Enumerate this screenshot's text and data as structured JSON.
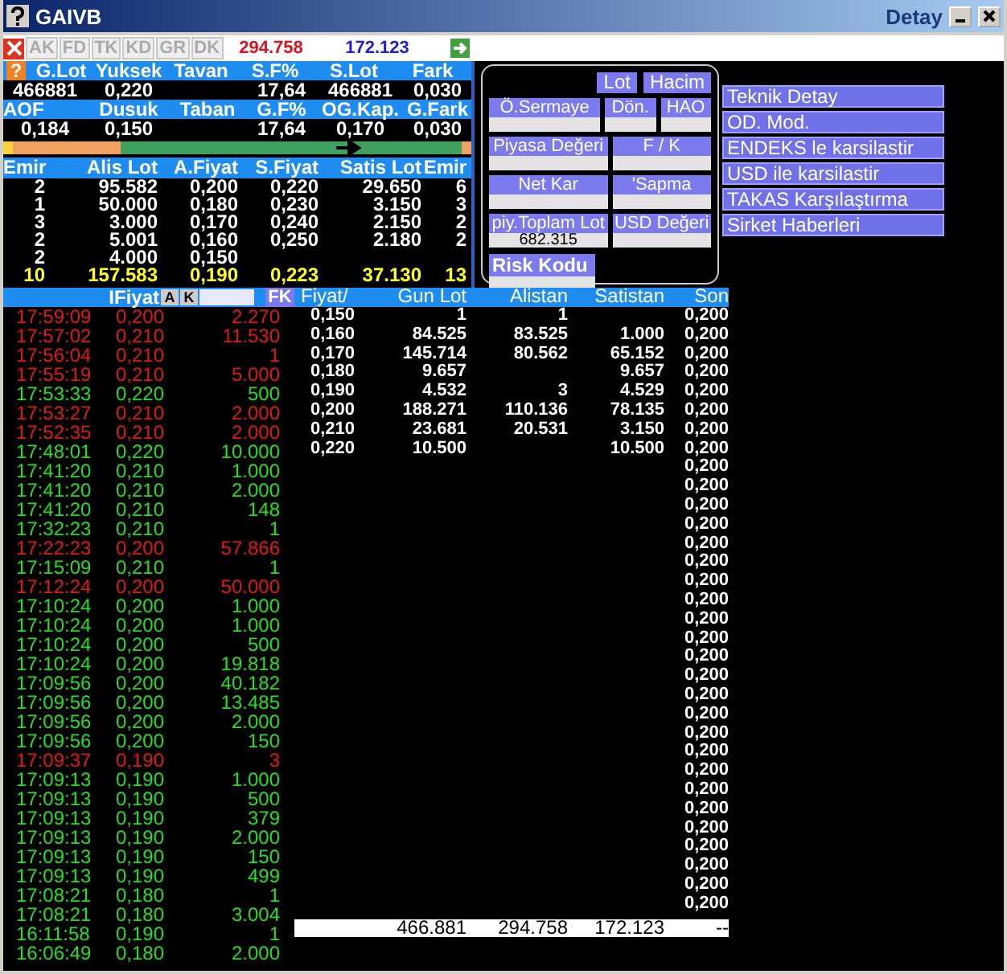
{
  "window": {
    "title": "GAIVB",
    "subtitle": "Detay"
  },
  "toolbar": {
    "tabs": [
      {
        "label": "AK"
      },
      {
        "label": "FD"
      },
      {
        "label": "TK"
      },
      {
        "label": "KD"
      },
      {
        "label": "GR"
      },
      {
        "label": "DK"
      }
    ],
    "sell_total": "294.758",
    "buy_total": "172.123"
  },
  "summary": {
    "help": "?",
    "rows": [
      {
        "kind": "header",
        "cells": [
          "G.Lot",
          "Yuksek",
          "Tavan",
          "S.F%",
          "S.Lot",
          "Fark"
        ]
      },
      {
        "kind": "value",
        "cells": [
          "466881",
          "0,220",
          null,
          "17,64",
          "466881",
          "0,030"
        ]
      },
      {
        "kind": "header",
        "cells": [
          "AOF",
          "Dusuk",
          "Taban",
          "G.F%",
          "OG.Kap.",
          "G.Fark"
        ]
      },
      {
        "kind": "value",
        "cells": [
          "0,184",
          "0,150",
          null,
          "17,64",
          "0,170",
          "0,030"
        ]
      }
    ],
    "balance": {
      "level": 0.24
    }
  },
  "depth": {
    "columns": [
      "Emir",
      "Alis Lot",
      "A.Fiyat",
      "S.Fiyat",
      "Satis Lot",
      "Emir"
    ],
    "rows": [
      {
        "kind": "level",
        "cells": [
          "2",
          "95.582",
          "0,200",
          "0,220",
          "29.650",
          "6"
        ]
      },
      {
        "kind": "level",
        "cells": [
          "1",
          "50.000",
          "0,180",
          "0,230",
          "3.150",
          "3"
        ]
      },
      {
        "kind": "level",
        "cells": [
          "3",
          "3.000",
          "0,170",
          "0,240",
          "2.150",
          "2"
        ]
      },
      {
        "kind": "level",
        "cells": [
          "2",
          "5.001",
          "0,160",
          "0,250",
          "2.180",
          "2"
        ]
      },
      {
        "kind": "level",
        "cells": [
          "2",
          "4.000",
          "0,150",
          null,
          null,
          null
        ]
      },
      {
        "kind": "total",
        "cells": [
          "10",
          "157.583",
          "0,190",
          "0,223",
          "37.130",
          "13"
        ]
      }
    ]
  },
  "info_panel": {
    "tabs": [
      {
        "label": "Lot",
        "selected": false
      },
      {
        "label": "Hacim",
        "selected": false
      }
    ],
    "rows": [
      [
        {
          "label": "Ö.Sermaye"
        },
        {
          "label": "Dön."
        },
        {
          "label": "HAO"
        }
      ],
      [
        {
          "label": "Piyasa Değeri"
        },
        {
          "label": "F / K"
        }
      ],
      [
        {
          "label": "Net Kar"
        },
        {
          "label": "'Sapma"
        }
      ],
      [
        {
          "label": "piy.Toplam Lot",
          "value": "682.315"
        },
        {
          "label": "USD Değeri"
        }
      ]
    ],
    "risk_label": "Risk Kodu"
  },
  "menu": [
    "Teknik Detay",
    "OD. Mod.",
    "ENDEKS le karsilastir",
    "USD ile karsilastir",
    "TAKAS Karşılaştırma",
    "Sirket Haberleri"
  ],
  "trades": {
    "price_header": "IFiyat",
    "buttons": [
      "A",
      "K"
    ],
    "fk_button": "FK",
    "rows": [
      {
        "time": "17:59:09",
        "price": "0,200",
        "qty": "2.270",
        "kind": "down"
      },
      {
        "time": "17:57:02",
        "price": "0,210",
        "qty": "11.530",
        "kind": "down"
      },
      {
        "time": "17:56:04",
        "price": "0,210",
        "qty": "1",
        "kind": "down"
      },
      {
        "time": "17:55:19",
        "price": "0,210",
        "qty": "5.000",
        "kind": "down"
      },
      {
        "time": "17:53:33",
        "price": "0,220",
        "qty": "500",
        "kind": "up"
      },
      {
        "time": "17:53:27",
        "price": "0,210",
        "qty": "2.000",
        "kind": "down"
      },
      {
        "time": "17:52:35",
        "price": "0,210",
        "qty": "2.000",
        "kind": "down"
      },
      {
        "time": "17:48:01",
        "price": "0,220",
        "qty": "10.000",
        "kind": "up"
      },
      {
        "time": "17:41:20",
        "price": "0,210",
        "qty": "1.000",
        "kind": "up"
      },
      {
        "time": "17:41:20",
        "price": "0,210",
        "qty": "2.000",
        "kind": "up"
      },
      {
        "time": "17:41:20",
        "price": "0,210",
        "qty": "148",
        "kind": "up"
      },
      {
        "time": "17:32:23",
        "price": "0,210",
        "qty": "1",
        "kind": "up"
      },
      {
        "time": "17:22:23",
        "price": "0,200",
        "qty": "57.866",
        "kind": "down"
      },
      {
        "time": "17:15:09",
        "price": "0,210",
        "qty": "1",
        "kind": "up"
      },
      {
        "time": "17:12:24",
        "price": "0,200",
        "qty": "50.000",
        "kind": "down"
      },
      {
        "time": "17:10:24",
        "price": "0,200",
        "qty": "1.000",
        "kind": "up"
      },
      {
        "time": "17:10:24",
        "price": "0,200",
        "qty": "1.000",
        "kind": "up"
      },
      {
        "time": "17:10:24",
        "price": "0,200",
        "qty": "500",
        "kind": "up"
      },
      {
        "time": "17:10:24",
        "price": "0,200",
        "qty": "19.818",
        "kind": "up"
      },
      {
        "time": "17:09:56",
        "price": "0,200",
        "qty": "40.182",
        "kind": "up"
      },
      {
        "time": "17:09:56",
        "price": "0,200",
        "qty": "13.485",
        "kind": "up"
      },
      {
        "time": "17:09:56",
        "price": "0,200",
        "qty": "2.000",
        "kind": "up"
      },
      {
        "time": "17:09:56",
        "price": "0,200",
        "qty": "150",
        "kind": "up"
      },
      {
        "time": "17:09:37",
        "price": "0,190",
        "qty": "3",
        "kind": "down"
      },
      {
        "time": "17:09:13",
        "price": "0,190",
        "qty": "1.000",
        "kind": "up"
      },
      {
        "time": "17:09:13",
        "price": "0,190",
        "qty": "500",
        "kind": "up"
      },
      {
        "time": "17:09:13",
        "price": "0,190",
        "qty": "379",
        "kind": "up"
      },
      {
        "time": "17:09:13",
        "price": "0,190",
        "qty": "2.000",
        "kind": "up"
      },
      {
        "time": "17:09:13",
        "price": "0,190",
        "qty": "150",
        "kind": "up"
      },
      {
        "time": "17:09:13",
        "price": "0,190",
        "qty": "499",
        "kind": "up"
      },
      {
        "time": "17:08:21",
        "price": "0,180",
        "qty": "1",
        "kind": "up"
      },
      {
        "time": "17:08:21",
        "price": "0,180",
        "qty": "3.004",
        "kind": "up"
      },
      {
        "time": "16:11:58",
        "price": "0,190",
        "qty": "1",
        "kind": "up"
      },
      {
        "time": "16:06:49",
        "price": "0,180",
        "qty": "2.000",
        "kind": "up"
      }
    ]
  },
  "price_table": {
    "columns": [
      "Fiyat/",
      "Gun Lot",
      "Alistan",
      "Satistan",
      "Son"
    ],
    "rows": [
      [
        "0,150",
        "1",
        "1",
        null,
        "0,200"
      ],
      [
        "0,160",
        "84.525",
        "83.525",
        "1.000",
        "0,200"
      ],
      [
        "0,170",
        "145.714",
        "80.562",
        "65.152",
        "0,200"
      ],
      [
        "0,180",
        "9.657",
        null,
        "9.657",
        "0,200"
      ],
      [
        "0,190",
        "4.532",
        "3",
        "4.529",
        "0,200"
      ],
      [
        "0,200",
        "188.271",
        "110.136",
        "78.135",
        "0,200"
      ],
      [
        "0,210",
        "23.681",
        "20.531",
        "3.150",
        "0,200"
      ],
      [
        "0,220",
        "10.500",
        null,
        "10.500",
        "0,200"
      ],
      [
        null,
        null,
        null,
        null,
        "0,200"
      ],
      [
        null,
        null,
        null,
        null,
        "0,200"
      ],
      [
        null,
        null,
        null,
        null,
        "0,200"
      ],
      [
        null,
        null,
        null,
        null,
        "0,200"
      ],
      [
        null,
        null,
        null,
        null,
        "0,200"
      ],
      [
        null,
        null,
        null,
        null,
        "0,200"
      ],
      [
        null,
        null,
        null,
        null,
        "0,200"
      ],
      [
        null,
        null,
        null,
        null,
        "0,200"
      ],
      [
        null,
        null,
        null,
        null,
        "0,200"
      ],
      [
        null,
        null,
        null,
        null,
        "0,200"
      ],
      [
        null,
        null,
        null,
        null,
        "0,200"
      ],
      [
        null,
        null,
        null,
        null,
        "0,200"
      ],
      [
        null,
        null,
        null,
        null,
        "0,200"
      ],
      [
        null,
        null,
        null,
        null,
        "0,200"
      ],
      [
        null,
        null,
        null,
        null,
        "0,200"
      ],
      [
        null,
        null,
        null,
        null,
        "0,200"
      ],
      [
        null,
        null,
        null,
        null,
        "0,200"
      ],
      [
        null,
        null,
        null,
        null,
        "0,200"
      ],
      [
        null,
        null,
        null,
        null,
        "0,200"
      ],
      [
        null,
        null,
        null,
        null,
        "0,200"
      ],
      [
        null,
        null,
        null,
        null,
        "0,200"
      ],
      [
        null,
        null,
        null,
        null,
        "0,200"
      ],
      [
        null,
        null,
        null,
        null,
        "0,200"
      ],
      [
        null,
        null,
        null,
        null,
        "0,200"
      ]
    ],
    "total": [
      "466.881",
      "294.758",
      "172.123",
      "--"
    ]
  }
}
